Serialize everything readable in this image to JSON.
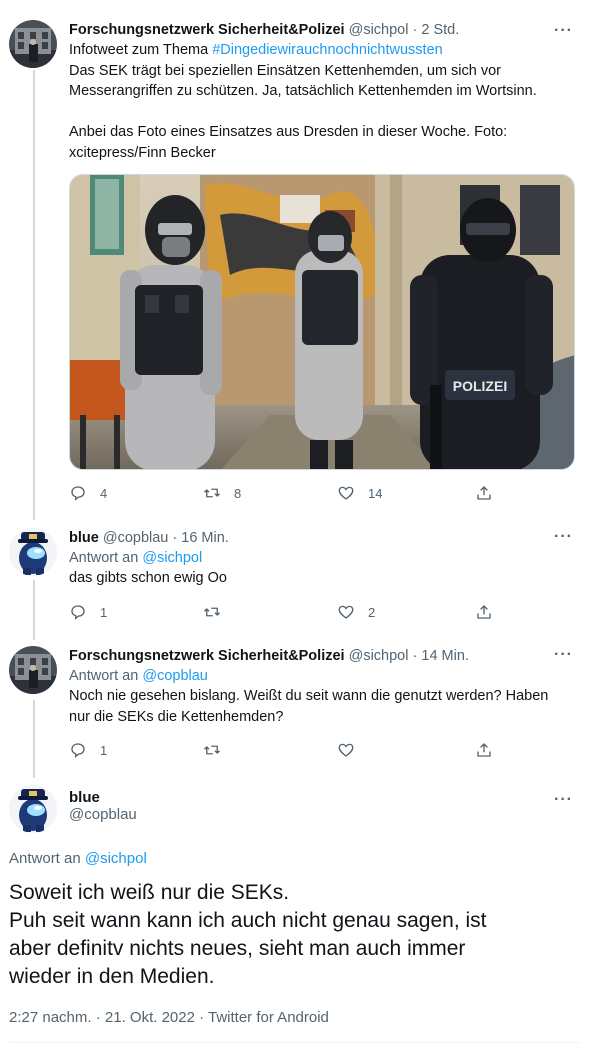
{
  "tweets": [
    {
      "name": "Forschungsnetzwerk Sicherheit&Polizei",
      "handle": "@sichpol",
      "time": "2 Std.",
      "line1_prefix": "Infotweet zum Thema ",
      "hashtag": "#Dingediewirauchnochnichtwussten",
      "line2": "Das SEK trägt bei speziellen Einsätzen Kettenhemden, um sich vor",
      "line3": "Messerangriffen zu schützen. Ja, tatsächlich Kettenhemden im Wortsinn.",
      "line4": "Anbei das Foto eines Einsatzes aus Dresden in dieser Woche. Foto:",
      "line5": "xcitepress/Finn Becker",
      "photo_text": "POLIZEI",
      "replies": "4",
      "retweets": "8",
      "likes": "14"
    },
    {
      "name": "blue",
      "handle": "@copblau",
      "time": "16 Min.",
      "reply_prefix": "Antwort an ",
      "reply_to": "@sichpol",
      "text": "das gibts schon ewig Oo",
      "replies": "1",
      "retweets": "",
      "likes": "2"
    },
    {
      "name": "Forschungsnetzwerk Sicherheit&Polizei",
      "handle": "@sichpol",
      "time": "14 Min.",
      "reply_prefix": "Antwort an ",
      "reply_to": "@copblau",
      "line1": "Noch nie gesehen bislang. Weißt du seit wann die genutzt werden? Haben",
      "line2": "nur die SEKs die Kettenhemden?",
      "replies": "1",
      "retweets": "",
      "likes": ""
    }
  ],
  "main_tweet": {
    "name": "blue",
    "handle": "@copblau",
    "reply_prefix": "Antwort an ",
    "reply_to": "@sichpol",
    "line1": "Soweit ich weiß nur die SEKs.",
    "line2": "Puh seit wann kann ich auch nicht genau sagen, ist",
    "line3": "aber definitv nichts neues, sieht man auch immer",
    "line4": "wieder in den Medien.",
    "meta": "2:27 nachm. · 21. Okt. 2022 · Twitter for Android"
  },
  "separator": "·",
  "more_label": "···",
  "icons": [
    "reply-icon",
    "retweet-icon",
    "like-icon",
    "share-icon",
    "more-icon"
  ],
  "colors": {
    "link": "#1d9bf0",
    "secondary": "#536471",
    "text": "#0f1419",
    "thread_line": "#cfd9de"
  }
}
